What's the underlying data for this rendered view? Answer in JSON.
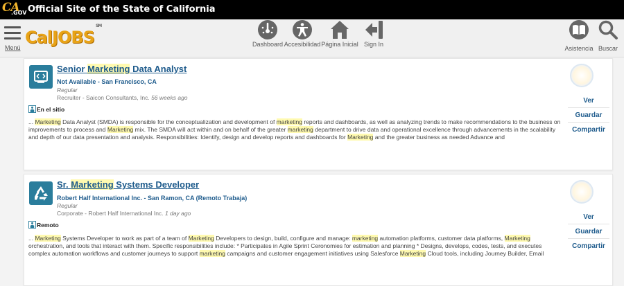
{
  "state_bar": {
    "logo_text": "CA",
    "logo_gov": ".GOV",
    "title": "Official Site of the State of California"
  },
  "nav": {
    "menu_label": "Menú",
    "logo_text": "CalJOBS",
    "logo_sm": "SM",
    "items": [
      {
        "label": "Dashboard",
        "icon": "dashboard-gauge-icon"
      },
      {
        "label": "Accesibilidad",
        "icon": "accessibility-icon"
      },
      {
        "label": "Página Inicial",
        "icon": "home-icon"
      },
      {
        "label": "Sign In",
        "icon": "sign-in-icon"
      }
    ],
    "right_items": [
      {
        "label": "Asistencia",
        "icon": "book-icon"
      },
      {
        "label": "Buscar",
        "icon": "search-icon"
      }
    ]
  },
  "jobs": [
    {
      "title_pre": "Senior ",
      "title_hl": "Marketing",
      "title_post": " Data Analyst",
      "company": "Not Available - San Francisco, CA",
      "type": "Regular",
      "recruiter": "Recruiter - Saicon Consultants, Inc.",
      "age": "56 weeks ago",
      "location_type": "En el sitio",
      "icon": "analytics-screen-icon",
      "desc": [
        {
          "t": "... ",
          "h": false
        },
        {
          "t": "Marketing",
          "h": true
        },
        {
          "t": " Data Analyst (SMDA) is responsible for the conceptualization and development of ",
          "h": false
        },
        {
          "t": "marketing",
          "h": true
        },
        {
          "t": " reports and dashboards, as well as analyzing trends to make recommendations to the business on improvements to process and ",
          "h": false
        },
        {
          "t": "Marketing",
          "h": true
        },
        {
          "t": " mix. The SMDA will act within and on behalf of the greater ",
          "h": false
        },
        {
          "t": "marketing",
          "h": true
        },
        {
          "t": " department to drive data and operational excellence through advancements in the scalability and depth of our data presentation and analysis. Responsibilities: Identify, design and develop reports and dashboards for ",
          "h": false
        },
        {
          "t": "Marketing",
          "h": true
        },
        {
          "t": " and the greater business as needed Advance and",
          "h": false
        }
      ],
      "actions": [
        "Ver",
        "Guardar",
        "Compartir"
      ]
    },
    {
      "title_pre": "Sr. ",
      "title_hl": "Marketing",
      "title_post": " Systems Developer",
      "company": "Robert Half International Inc. - San Ramon, CA (Remoto Trabaja)",
      "type": "Regular",
      "recruiter": "Corporate - Robert Half International Inc.",
      "age": "1 day ago",
      "location_type": "Remoto",
      "icon": "recycle-icon",
      "desc": [
        {
          "t": "... ",
          "h": false
        },
        {
          "t": "Marketing",
          "h": true
        },
        {
          "t": " Systems Developer to work as part of a team of ",
          "h": false
        },
        {
          "t": "Marketing",
          "h": true
        },
        {
          "t": " Developers to design, build, configure and manage: ",
          "h": false
        },
        {
          "t": "marketing",
          "h": true
        },
        {
          "t": " automation platforms, customer data platforms, ",
          "h": false
        },
        {
          "t": "Marketing",
          "h": true
        },
        {
          "t": " orchestration, and tools that interact with them. Specific responsibilities include: * Participates in Agile Sprint Ceronomies for estimation and planning * Designs, develops, codes, tests, and executes complex automation workflows and customer journeys to support ",
          "h": false
        },
        {
          "t": "marketing",
          "h": true
        },
        {
          "t": " campaigns and customer engagement initiatives using Salesforce ",
          "h": false
        },
        {
          "t": "Marketing",
          "h": true
        },
        {
          "t": " Cloud tools, including Journey Builder, Email",
          "h": false
        }
      ],
      "actions": [
        "Ver",
        "Guardar",
        "Compartir"
      ]
    }
  ]
}
